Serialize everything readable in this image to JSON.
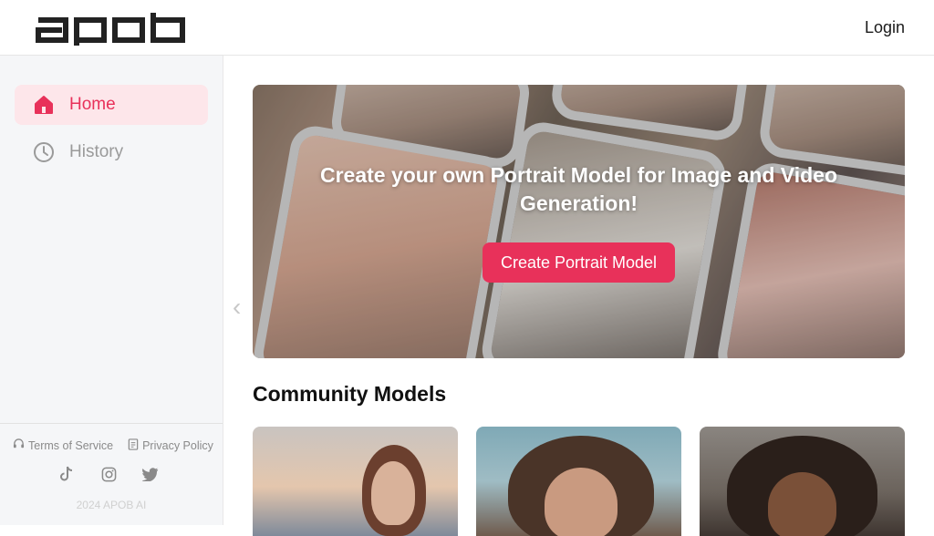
{
  "header": {
    "logo_text": "apob",
    "login_label": "Login"
  },
  "sidebar": {
    "items": [
      {
        "label": "Home",
        "icon": "home-icon",
        "active": true
      },
      {
        "label": "History",
        "icon": "clock-icon",
        "active": false
      }
    ],
    "footer": {
      "terms_label": "Terms of Service",
      "privacy_label": "Privacy Policy",
      "social": [
        "tiktok-icon",
        "instagram-icon",
        "twitter-icon"
      ],
      "copyright": "2024 APOB AI"
    }
  },
  "banner": {
    "title": "Create your own Portrait Model for Image and Video Generation!",
    "button_label": "Create Portrait Model"
  },
  "community": {
    "title": "Community Models"
  },
  "colors": {
    "accent": "#e8315a",
    "active_bg": "#fde6ea",
    "sidebar_bg": "#f5f6f8"
  }
}
